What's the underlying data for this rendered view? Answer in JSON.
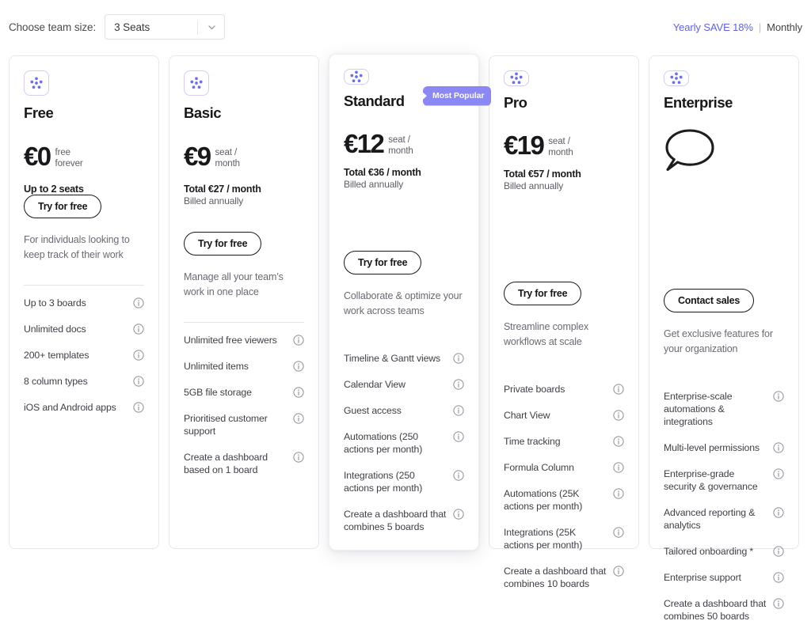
{
  "toolbar": {
    "team_size_label": "Choose team size:",
    "team_size_value": "3 Seats",
    "team_size_options": [
      "3 Seats"
    ],
    "chevron_icon": "chevron-down-icon",
    "billing_yearly": "Yearly SAVE 18%",
    "billing_separator": "|",
    "billing_monthly": "Monthly",
    "accent_color": "#6161e8"
  },
  "theme": {
    "brand_purple": "#6c6cf0",
    "badge_purple": "#8b87f3",
    "logo_icon": "monday-dots-icon",
    "card_border": "#e8e8ec",
    "text_primary": "#18181b",
    "text_muted": "#6a6a74"
  },
  "plans": [
    {
      "id": "free",
      "name": "Free",
      "logo_icon": "monday-dots-icon",
      "badge": null,
      "price_main": "€0",
      "price_unit": "free\nforever",
      "total_line": null,
      "billed_line": null,
      "seats_line": "Up to 2 seats",
      "show_bubble": false,
      "cta_label": "Try for free",
      "tagline": "For individuals looking to keep track of their work",
      "features": [
        "Up to 3 boards",
        "Unlimited docs",
        "200+ templates",
        "8 column types",
        "iOS and Android apps"
      ]
    },
    {
      "id": "basic",
      "name": "Basic",
      "logo_icon": "monday-dots-icon",
      "badge": null,
      "price_main": "€9",
      "price_unit": "seat /\nmonth",
      "total_line": "Total €27 / month",
      "billed_line": "Billed annually",
      "seats_line": null,
      "show_bubble": false,
      "cta_label": "Try for free",
      "tagline": "Manage all your team’s work in one place",
      "features": [
        "Unlimited free viewers",
        "Unlimited items",
        "5GB file storage",
        "Prioritised customer support",
        "Create a dashboard based on 1 board"
      ]
    },
    {
      "id": "standard",
      "name": "Standard",
      "logo_icon": "monday-dots-icon",
      "badge": "Most Popular",
      "price_main": "€12",
      "price_unit": "seat /\nmonth",
      "total_line": "Total €36 / month",
      "billed_line": "Billed annually",
      "seats_line": null,
      "show_bubble": false,
      "cta_label": "Try for free",
      "tagline": "Collaborate & optimize your work across teams",
      "features": [
        "Timeline & Gantt views",
        "Calendar View",
        "Guest access",
        "Automations (250 actions per month)",
        "Integrations (250 actions per month)",
        "Create a dashboard that combines 5 boards"
      ]
    },
    {
      "id": "pro",
      "name": "Pro",
      "logo_icon": "monday-dots-icon",
      "badge": null,
      "price_main": "€19",
      "price_unit": "seat /\nmonth",
      "total_line": "Total €57 / month",
      "billed_line": "Billed annually",
      "seats_line": null,
      "show_bubble": false,
      "cta_label": "Try for free",
      "tagline": "Streamline complex workflows at scale",
      "features": [
        "Private boards",
        "Chart View",
        "Time tracking",
        "Formula Column",
        "Automations (25K actions per month)",
        "Integrations (25K actions per month)",
        "Create a dashboard that combines 10 boards"
      ]
    },
    {
      "id": "enterprise",
      "name": "Enterprise",
      "logo_icon": "monday-dots-icon",
      "badge": null,
      "price_main": null,
      "price_unit": null,
      "total_line": null,
      "billed_line": null,
      "seats_line": null,
      "show_bubble": true,
      "bubble_icon": "speech-bubble-icon",
      "cta_label": "Contact sales",
      "tagline": "Get exclusive features for your organization",
      "features": [
        "Enterprise-scale automations & integrations",
        "Multi-level permissions",
        "Enterprise-grade security & governance",
        "Advanced reporting & analytics",
        "Tailored onboarding *",
        "Enterprise support",
        "Create a dashboard that combines 50 boards"
      ]
    }
  ],
  "icons": {
    "info": "info-circle-icon"
  }
}
